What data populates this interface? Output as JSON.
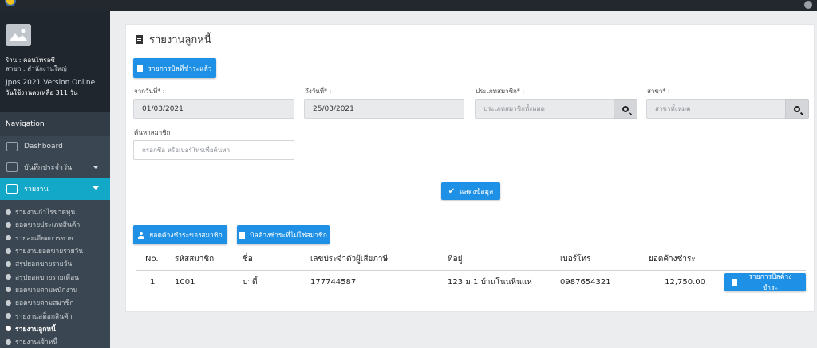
{
  "sidebar": {
    "shop": "ร้าน : คอนโทรลซี",
    "branch": "สาขา : สำนักงานใหญ่",
    "version": "Jpos 2021 Version Online",
    "days_left": "วันใช้งานคงเหลือ 311 วัน",
    "nav_title": "Navigation",
    "nav_items": [
      {
        "label": "Dashboard"
      },
      {
        "label": "บันทึกประจำวัน"
      },
      {
        "label": "รายงาน"
      }
    ],
    "report_items": [
      "รายงานกำไรขาดทุน",
      "ยอดขายประเภทสินค้า",
      "รายละเอียดการขาย",
      "รายงานยอดขายรายวัน",
      "สรุปยอดขายรายวัน",
      "สรุปยอดขายรายเดือน",
      "ยอดขายตามพนักงาน",
      "ยอดขายตามสมาชิก",
      "รายงานสต็อกสินค้า",
      "รายงานลูกหนี้",
      "รายงานเจ้าหนี้"
    ]
  },
  "page": {
    "title": "รายงานลูกหนี้",
    "paid_bills_button": "รายการบิลที่ชำระแล้ว",
    "show_button": "แสดงข้อมูล",
    "member_debt_button": "ยอดค้างชำระของสมาชิก",
    "nonmember_debt_button": "บิลค้างชำระที่ไม่ใช่สมาชิก"
  },
  "filters": {
    "from_label": "จากวันที่* :",
    "from_value": "01/03/2021",
    "to_label": "ถึงวันที่* :",
    "to_value": "25/03/2021",
    "member_type_label": "ประเภทสมาชิก* :",
    "member_type_placeholder": "ประเภทสมาชิกทั้งหมด",
    "branch_label": "สาขา* :",
    "branch_placeholder": "สาขาทั้งหมด",
    "search_label": "ค้นหาสมาชิก",
    "search_placeholder": "กรอกชื่อ หรือเบอร์โทรเพื่อค้นหา"
  },
  "table": {
    "headers": [
      "No.",
      "รหัสสมาชิก",
      "ชื่อ",
      "เลขประจำตัวผู้เสียภาษี",
      "ที่อยู่",
      "เบอร์โทร",
      "ยอดค้างชำระ",
      ""
    ],
    "rows": [
      {
        "no": "1",
        "code": "1001",
        "name": "ปาตี้",
        "tax_id": "177744587",
        "address": "123 ม.1 บ้านโนนหินแห่",
        "phone": "0987654321",
        "balance": "12,750.00",
        "action": "รายการบิลค้างชำระ"
      }
    ]
  },
  "colors": {
    "accent": "#1e90e6",
    "sidebar_active": "#14a8c8",
    "sidebar_bg": "#3a4651"
  }
}
